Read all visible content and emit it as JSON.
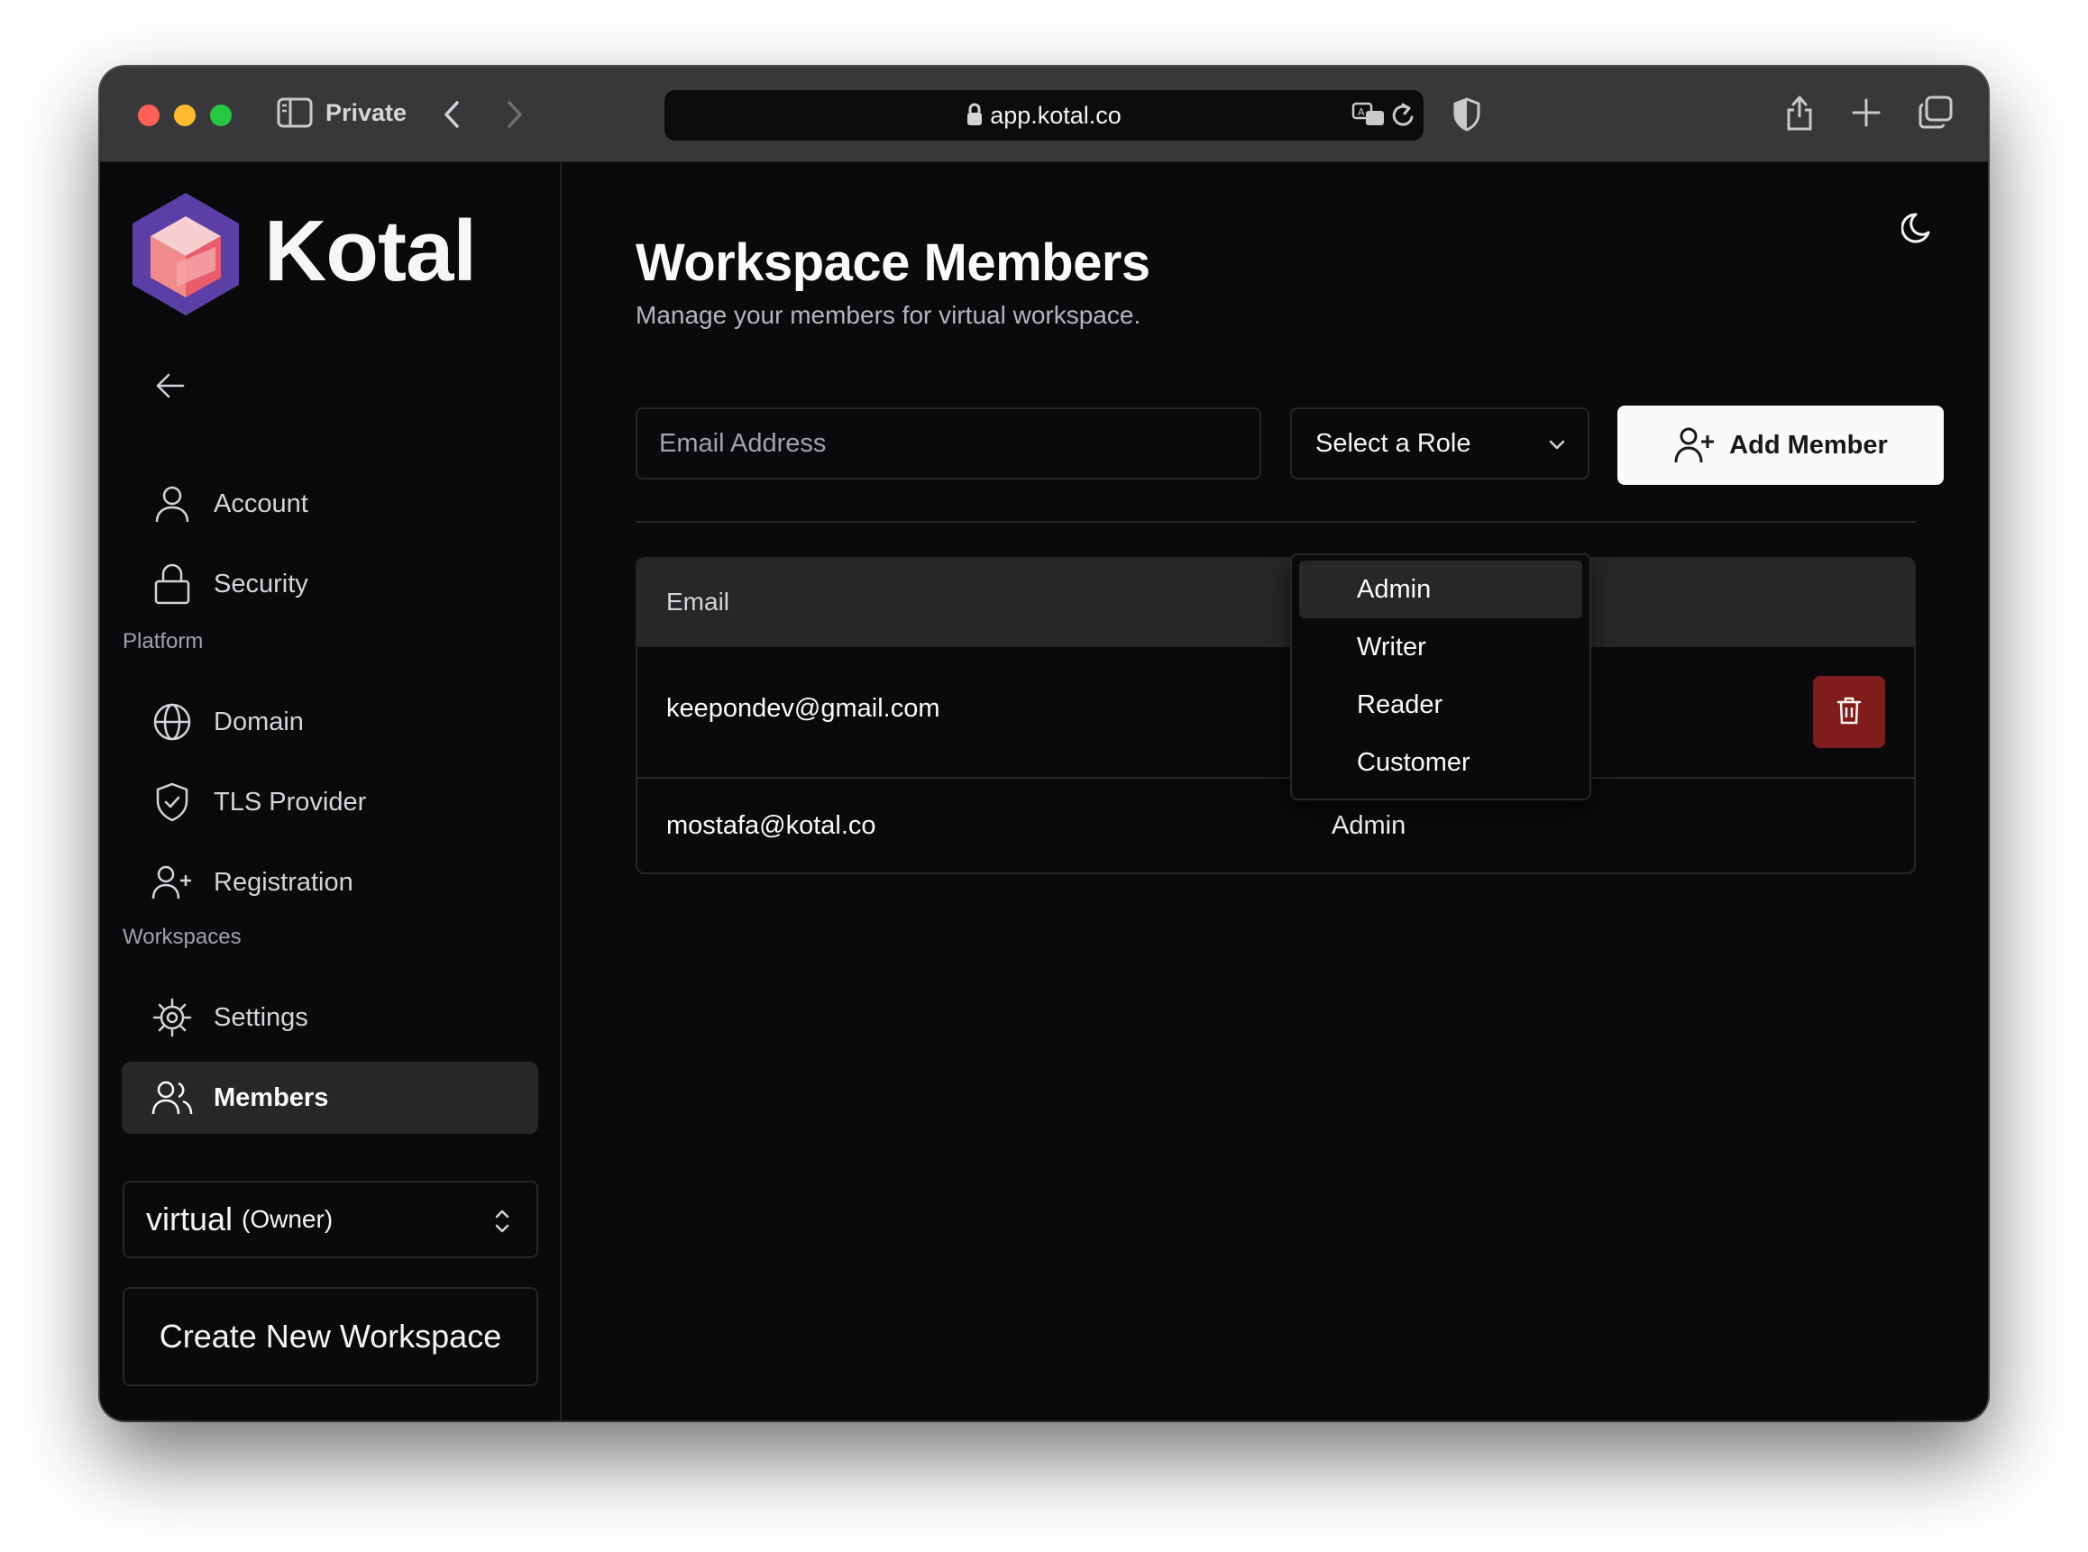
{
  "browser": {
    "private_label": "Private",
    "url": "app.kotal.co"
  },
  "sidebar": {
    "brand": "Kotal",
    "top_items": [
      {
        "label": "Account",
        "icon": "user-icon"
      },
      {
        "label": "Security",
        "icon": "lock-icon"
      }
    ],
    "platform_label": "Platform",
    "platform_items": [
      {
        "label": "Domain",
        "icon": "globe-icon"
      },
      {
        "label": "TLS Provider",
        "icon": "shield-check-icon"
      },
      {
        "label": "Registration",
        "icon": "user-plus-icon"
      }
    ],
    "workspaces_label": "Workspaces",
    "workspace_items": [
      {
        "label": "Settings",
        "icon": "gear-icon"
      },
      {
        "label": "Members",
        "icon": "users-icon",
        "active": true
      }
    ],
    "workspace_selector": {
      "name": "virtual",
      "role": "(Owner)"
    },
    "create_workspace_label": "Create New Workspace"
  },
  "main": {
    "title": "Workspace Members",
    "subtitle": "Manage your members for virtual workspace.",
    "form": {
      "email_placeholder": "Email Address",
      "role_placeholder": "Select a Role",
      "add_button_label": "Add Member"
    },
    "role_options": [
      "Admin",
      "Writer",
      "Reader",
      "Customer"
    ],
    "highlighted_option": "Admin",
    "table": {
      "headers": [
        "Email"
      ],
      "rows": [
        {
          "email": "keepondev@gmail.com",
          "role": "",
          "deletable": true
        },
        {
          "email": "mostafa@kotal.co",
          "role": "Admin",
          "deletable": false
        }
      ]
    }
  },
  "colors": {
    "background": "#0a0a0c",
    "accent_active": "#27272a",
    "danger": "#7f1d1d",
    "logo_hex": "#5b3fa6",
    "logo_cube": "#f28b8b"
  }
}
